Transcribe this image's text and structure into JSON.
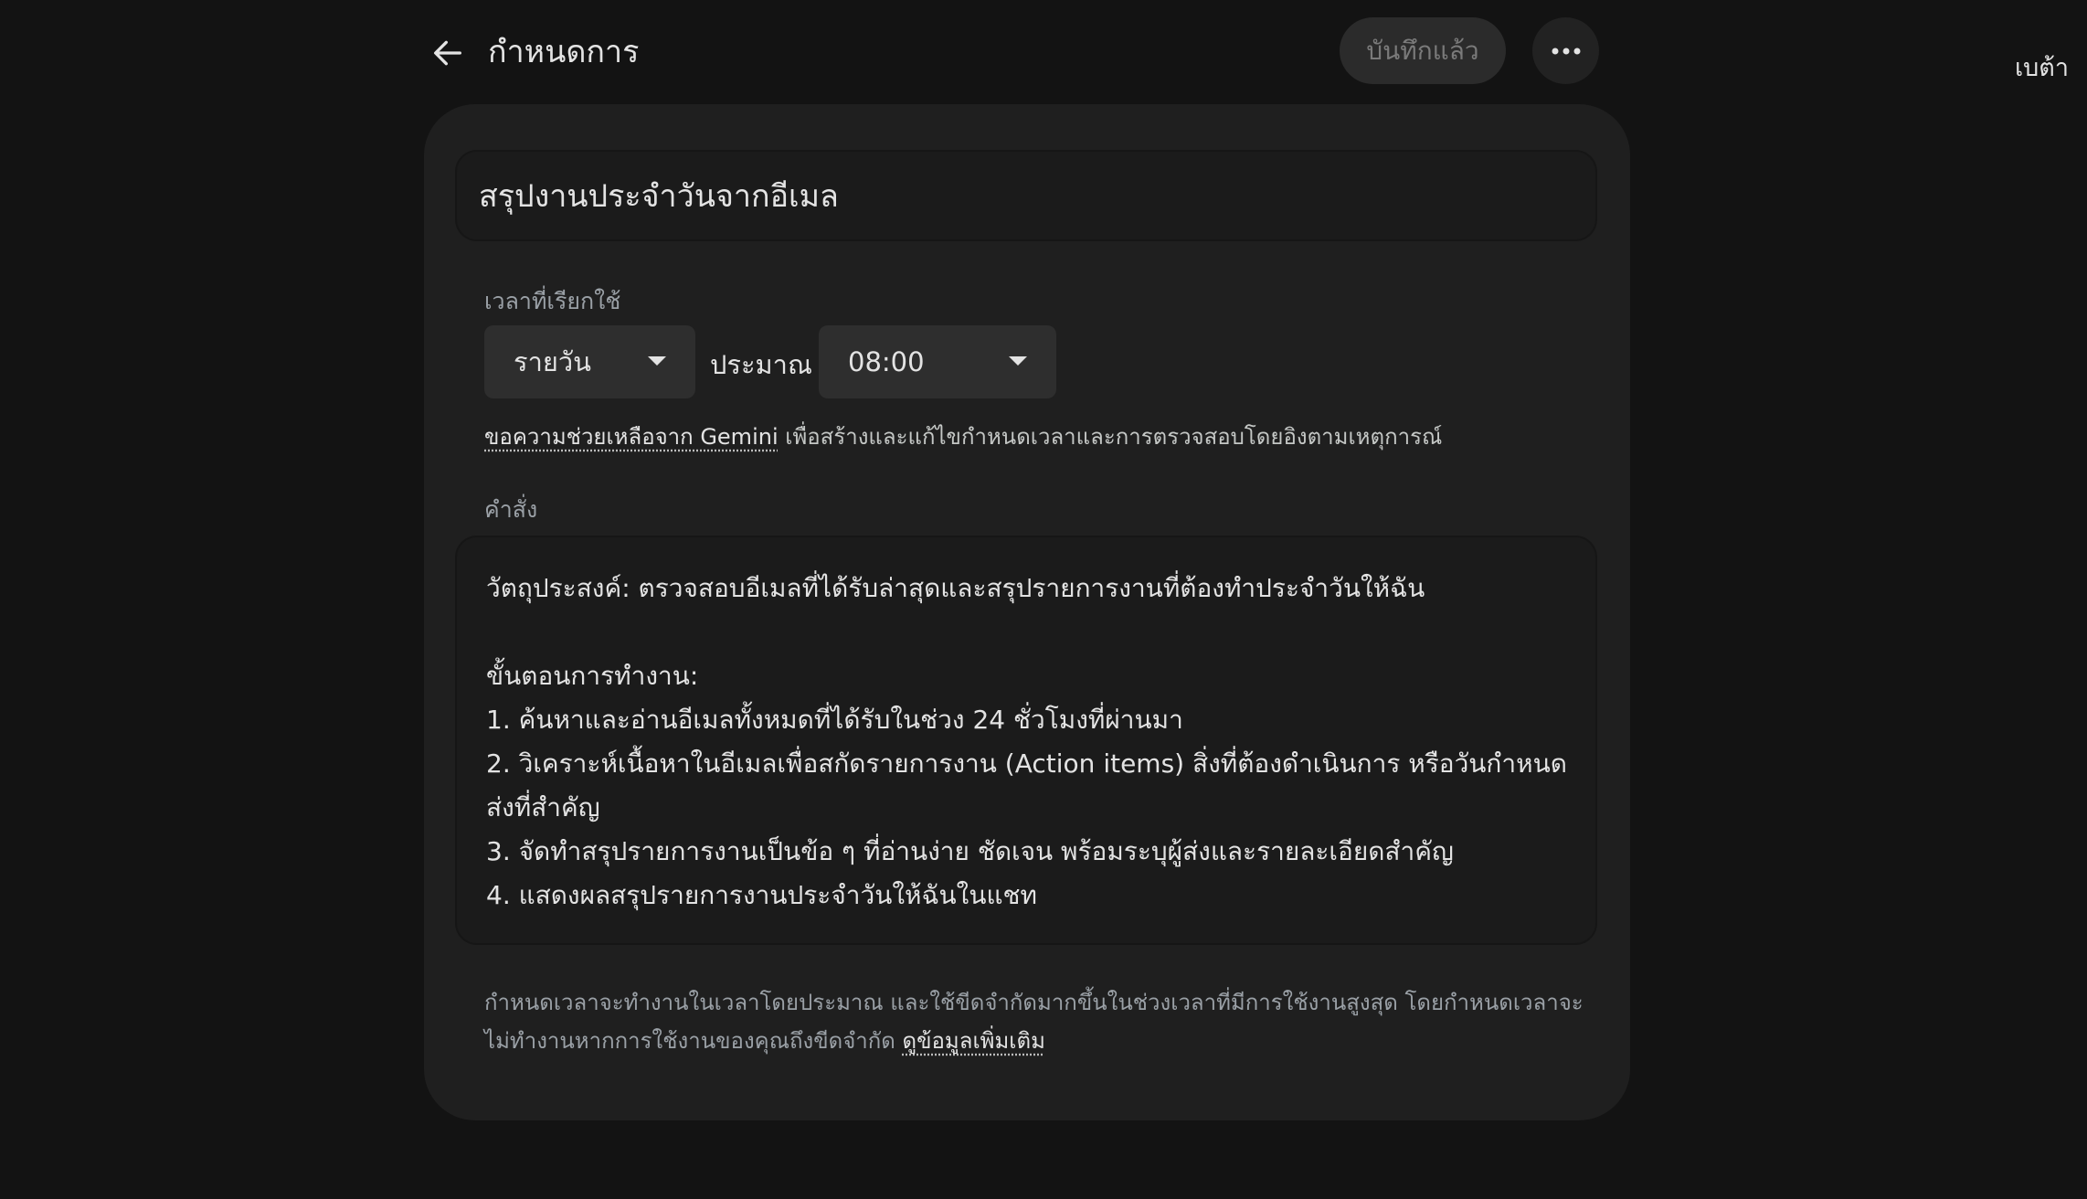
{
  "header": {
    "title": "กำหนดการ",
    "saved_label": "บันทึกแล้ว",
    "back_icon": "arrow-left-icon",
    "more_icon": "more-horizontal-icon"
  },
  "beta_label": "เบต้า",
  "schedule": {
    "name": "สรุปงานประจำวันจากอีเมล",
    "time_label": "เวลาที่เรียกใช้",
    "frequency": "รายวัน",
    "approx_label": "ประมาณ",
    "time": "08:00",
    "gemini_link": "ขอความช่วยเหลือจาก Gemini",
    "gemini_help_text": " เพื่อสร้างและแก้ไขกำหนดเวลาและการตรวจสอบโดยอิงตามเหตุการณ์",
    "instructions_label": "คำสั่ง",
    "instructions": {
      "objective": "วัตถุประสงค์: ตรวจสอบอีเมลที่ได้รับล่าสุดและสรุปรายการงานที่ต้องทำประจำวันให้ฉัน",
      "steps_title": "ขั้นตอนการทำงาน:",
      "step1": "1. ค้นหาและอ่านอีเมลทั้งหมดที่ได้รับในช่วง 24 ชั่วโมงที่ผ่านมา",
      "step2": "2. วิเคราะห์เนื้อหาในอีเมลเพื่อสกัดรายการงาน (Action items) สิ่งที่ต้องดำเนินการ หรือวันกำหนดส่งที่สำคัญ",
      "step3": "3. จัดทำสรุปรายการงานเป็นข้อ ๆ ที่อ่านง่าย ชัดเจน พร้อมระบุผู้ส่งและรายละเอียดสำคัญ",
      "step4": "4. แสดงผลสรุปรายการงานประจำวันให้ฉันในแชท"
    },
    "footer_text": "กำหนดเวลาจะทำงานในเวลาโดยประมาณ และใช้ขีดจำกัดมากขึ้นในช่วงเวลาที่มีการใช้งานสูงสุด โดยกำหนดเวลาจะไม่ทำงานหากการใช้งานของคุณถึงขีดจำกัด ",
    "learn_more": "ดูข้อมูลเพิ่มเติม"
  }
}
